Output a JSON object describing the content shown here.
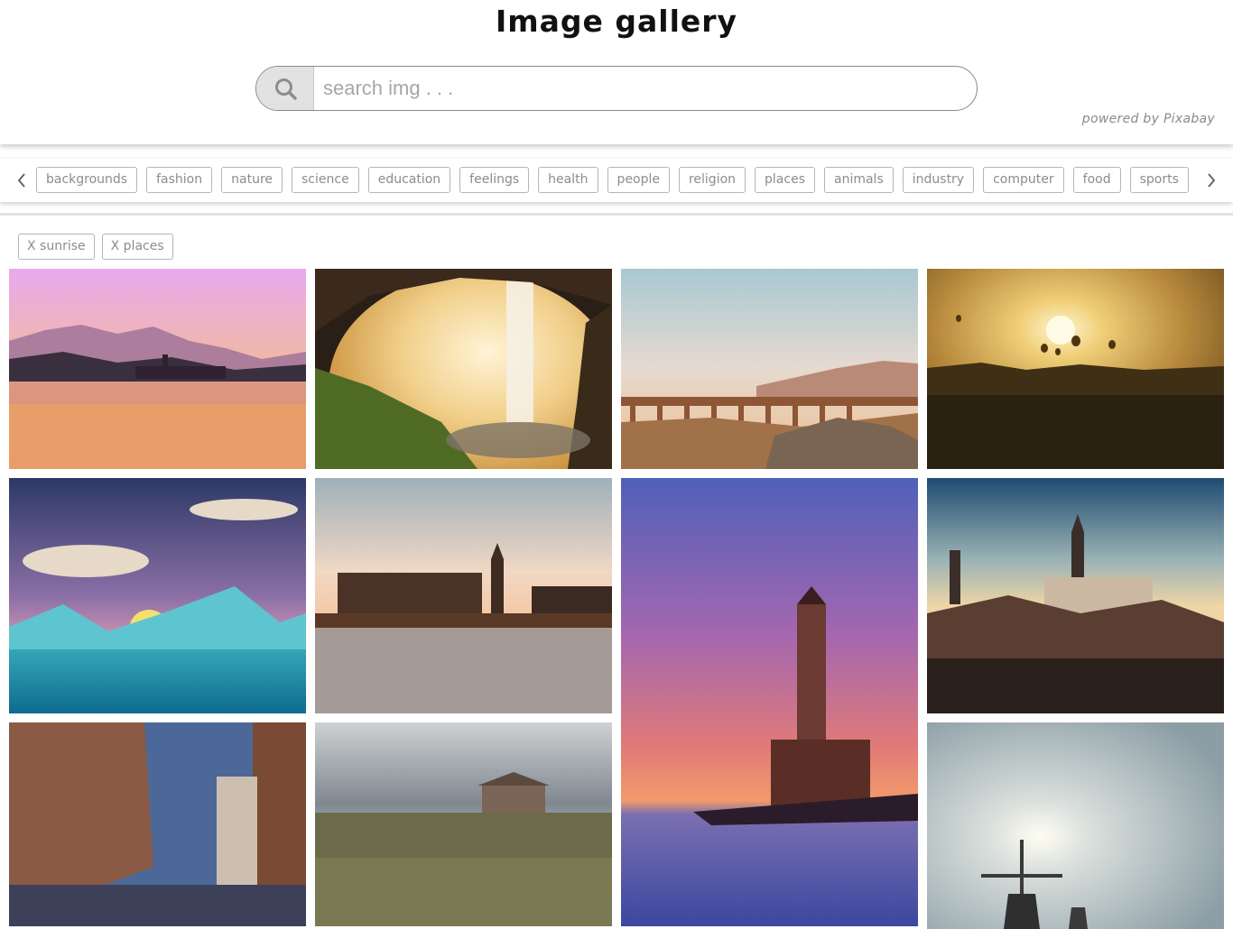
{
  "header": {
    "title": "Image gallery",
    "search_placeholder": "search img . . .",
    "search_value": "",
    "powered_by": "powered by Pixabay"
  },
  "categories": [
    "backgrounds",
    "fashion",
    "nature",
    "science",
    "education",
    "feelings",
    "health",
    "people",
    "religion",
    "places",
    "animals",
    "industry",
    "computer",
    "food",
    "sports"
  ],
  "active_filters": [
    "X sunrise",
    "X places"
  ],
  "icons": {
    "search": "search-icon",
    "prev": "chevron-left-icon",
    "next": "chevron-right-icon"
  },
  "gallery": [
    {
      "subject": "lake-island-church-sunrise"
    },
    {
      "subject": "waterfall-cave-sunset"
    },
    {
      "subject": "viaduct-hills-sunrise"
    },
    {
      "subject": "hot-air-balloons-sunrise"
    },
    {
      "subject": "cartoon-mountains-sunrise"
    },
    {
      "subject": "london-westminster-sunset"
    },
    {
      "subject": "lighthouse-sunset"
    },
    {
      "subject": "hilltop-town-sunrise"
    },
    {
      "subject": "rome-street-dusk"
    },
    {
      "subject": "barn-prairie-clouds"
    },
    {
      "subject": "windmills-sunrise"
    }
  ]
}
